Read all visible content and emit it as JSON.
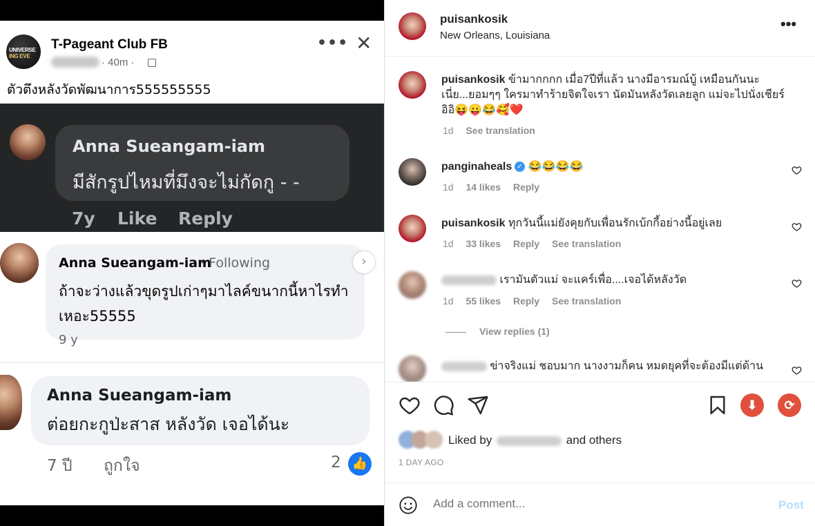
{
  "left_image": {
    "page_name": "T-Pageant Club FB",
    "logo_text_line1": "UNIVERSE",
    "logo_text_line2": "ING EVE",
    "time": "· 40m ·",
    "caption": "ตัวตึงหลังวัดพัฒนาการ555555555",
    "comment1": {
      "name": "Anna Sueangam-iam",
      "text": "มีสักรูปไหมที่มึงจะไม่กัดกู - -",
      "time": "7y",
      "like": "Like",
      "reply": "Reply"
    },
    "comment2": {
      "name": "Anna Sueangam-iam",
      "following": "· Following",
      "text": "ถ้าจะว่างแล้วขุดรูปเก่าๆมาไลค์ขนากนี้หาไรทำเหอะ55555",
      "time": "9 y"
    },
    "comment3": {
      "name": "Anna Sueangam-iam",
      "text": "ต่อยกะกูป่ะสาส หลังวัด เจอได้นะ",
      "time": "7 ปี",
      "like": "ถูกใจ",
      "count": "2"
    }
  },
  "instagram": {
    "username": "puisankosik",
    "location": "New Orleans, Louisiana",
    "caption": {
      "user": "puisankosik",
      "text": "ข้ามากกกก เมื่อ7ปีที่แล้ว นางมีอารมณ์บู้ เหมือนกันนะเนี่ย...ยอมๆๆ ใครมาทำร้ายจิตใจเรา นัดมันหลังวัดเลยลูก แม่จะไปนั่งเชียร์ อิอิ😝😛😂🥰❤️",
      "time": "1d",
      "see_translation": "See translation"
    },
    "comments": [
      {
        "user": "panginaheals",
        "verified": true,
        "text": "😂😂😂😂",
        "time": "1d",
        "likes": "14 likes",
        "reply": "Reply",
        "see_translation": ""
      },
      {
        "user": "puisankosik",
        "verified": false,
        "text": "ทุกวันนี้แม่ยังคุยกับเพื่อนรักเบ้กกี้อย่างนี้อยู่เลย",
        "time": "1d",
        "likes": "33 likes",
        "reply": "Reply",
        "see_translation": "See translation"
      },
      {
        "user": "",
        "verified": false,
        "text": "เรามันตัวแม่ จะแคร์เพื่อ....เจอได้หลังวัด",
        "time": "1d",
        "likes": "55 likes",
        "reply": "Reply",
        "see_translation": "See translation"
      },
      {
        "user": "",
        "verified": false,
        "text": "ข่าจริงแม่ ชอบมาก นางงามก็คน หมดยุคที่จะต้องมีแต่ด้าน"
      }
    ],
    "view_replies": "View replies (1)",
    "liked_by_prefix": "Liked by",
    "liked_by_suffix": "and others",
    "time_ago": "1 DAY AGO",
    "add_comment_placeholder": "Add a comment...",
    "post_label": "Post",
    "colors": {
      "download_icon_bg": "#e0503c",
      "repost_icon_bg": "#e0503c",
      "post_button": "#b2dffc",
      "verified_badge": "#3897f0"
    }
  }
}
